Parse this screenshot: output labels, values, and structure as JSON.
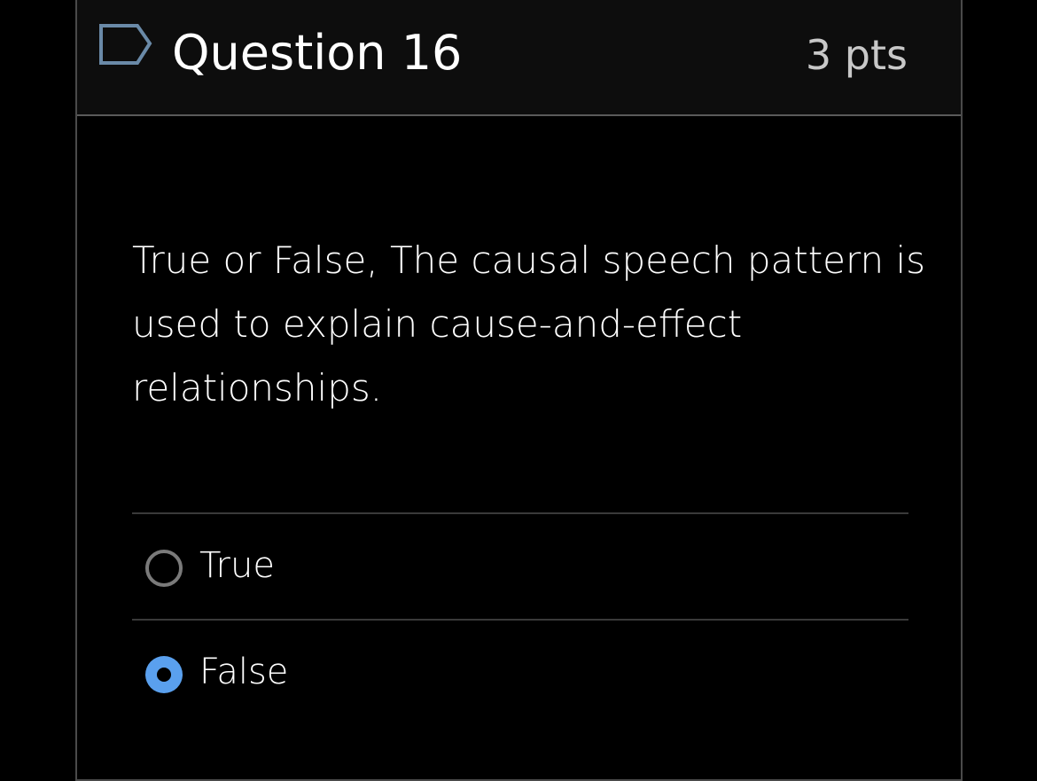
{
  "header": {
    "title": "Question 16",
    "points": "3 pts",
    "flag_icon": "flag-outline-icon"
  },
  "question": {
    "text": "True or False, The causal speech pattern is used to explain cause-and-effect relationships."
  },
  "answers": [
    {
      "label": "True",
      "selected": false
    },
    {
      "label": "False",
      "selected": true
    }
  ],
  "colors": {
    "background": "#000000",
    "header_background": "#0d0d0d",
    "radio_selected": "#5aa0ee",
    "radio_unselected": "#7a7a7a",
    "flag_outline": "#6a8aa8"
  }
}
